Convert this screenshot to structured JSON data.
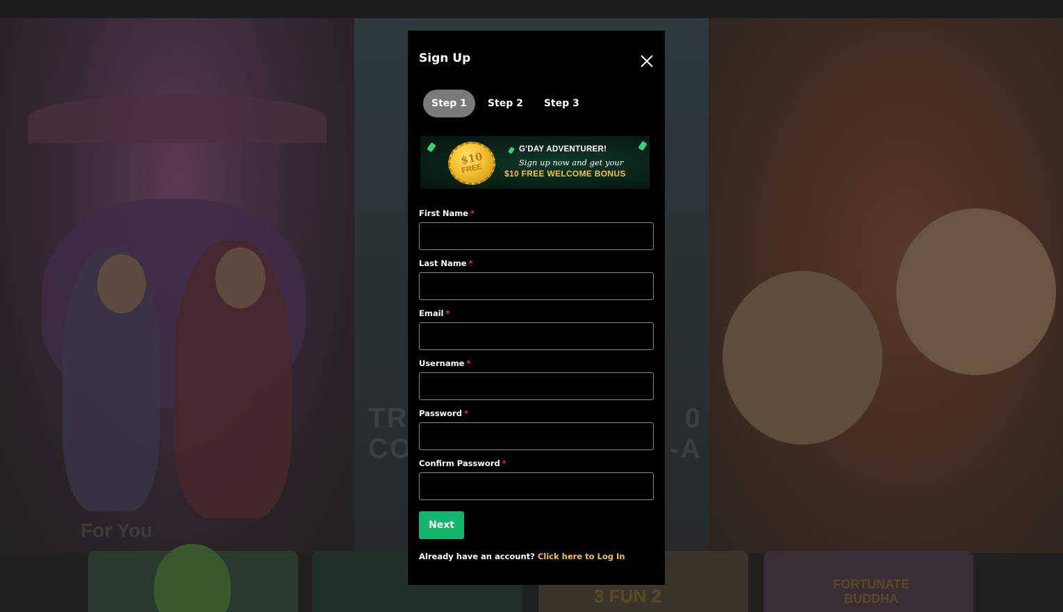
{
  "modal": {
    "title": "Sign Up",
    "close_icon": "close-icon",
    "steps": [
      {
        "label": "Step 1",
        "active": true
      },
      {
        "label": "Step 2",
        "active": false
      },
      {
        "label": "Step 3",
        "active": false
      }
    ],
    "promo": {
      "coin_amount": "$10",
      "coin_label": "FREE",
      "line1": "G'DAY ADVENTURER!",
      "line2": "Sign up now and get your",
      "line3": "$10 FREE WELCOME BONUS"
    },
    "fields": [
      {
        "label": "First Name",
        "value": "",
        "placeholder": ""
      },
      {
        "label": "Last Name",
        "value": "",
        "placeholder": ""
      },
      {
        "label": "Email",
        "value": "",
        "placeholder": ""
      },
      {
        "label": "Username",
        "value": "",
        "placeholder": ""
      },
      {
        "label": "Password",
        "value": "",
        "placeholder": ""
      },
      {
        "label": "Confirm Password",
        "value": "",
        "placeholder": ""
      }
    ],
    "required_marker": "*",
    "next_label": "Next",
    "login_prompt": "Already have an account?",
    "login_link": "Click here to Log In"
  },
  "background": {
    "banner_text_line1_left": "TR",
    "banner_text_line1_right": "0",
    "banner_text_line2_left": "CO",
    "banner_text_line2_right": "-A",
    "section_title": "For You",
    "tile3_text": "3 FUN 2",
    "tile4_text": "FORTUNATE BUDDHA"
  },
  "colors": {
    "accent_green": "#14b56a",
    "link_yellow": "#f3c534",
    "required_red": "#e33333",
    "modal_bg": "#000000",
    "active_step": "#7a7a7a"
  }
}
